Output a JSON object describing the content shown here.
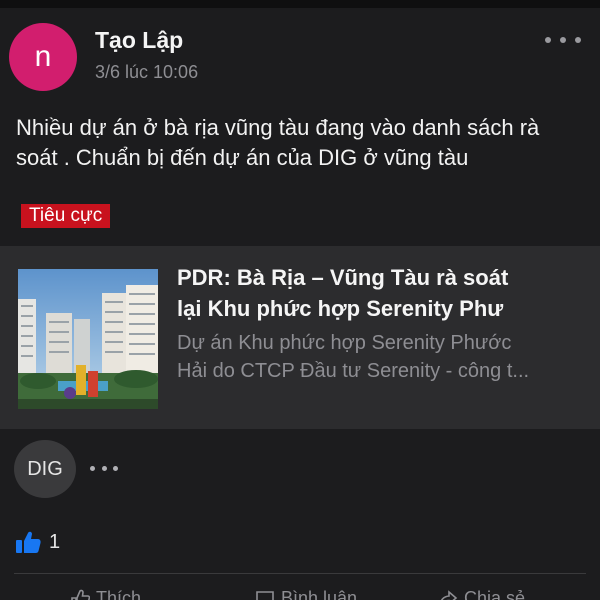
{
  "post": {
    "avatar_letter": "n",
    "author": "Tạo Lập",
    "timestamp": "3/6 lúc 10:06",
    "text": "Nhiều dự án ở bà rịa vũng tàu đang vào danh sách rà soát . Chuẩn bị đến dự án của DIG ở vũng tàu",
    "badge": "Tiêu cực",
    "avatar_color": "#d21e6e",
    "badge_color": "#c8121e"
  },
  "link_card": {
    "title_line1": "PDR: Bà Rịa – Vũng Tàu rà soát",
    "title_line2": "lại Khu phức hợp Serenity Phư",
    "desc_line1": "Dự án Khu phức hợp Serenity Phước",
    "desc_line2": "Hải do CTCP Đầu tư Serenity - công t..."
  },
  "tag": {
    "label": "DIG"
  },
  "reactions": {
    "icon": "thumbs-up-icon",
    "count": "1",
    "color": "#1877f2"
  },
  "actions": {
    "like_label": "Thích",
    "comment_label": "Bình luận",
    "share_label": "Chia sẻ"
  }
}
